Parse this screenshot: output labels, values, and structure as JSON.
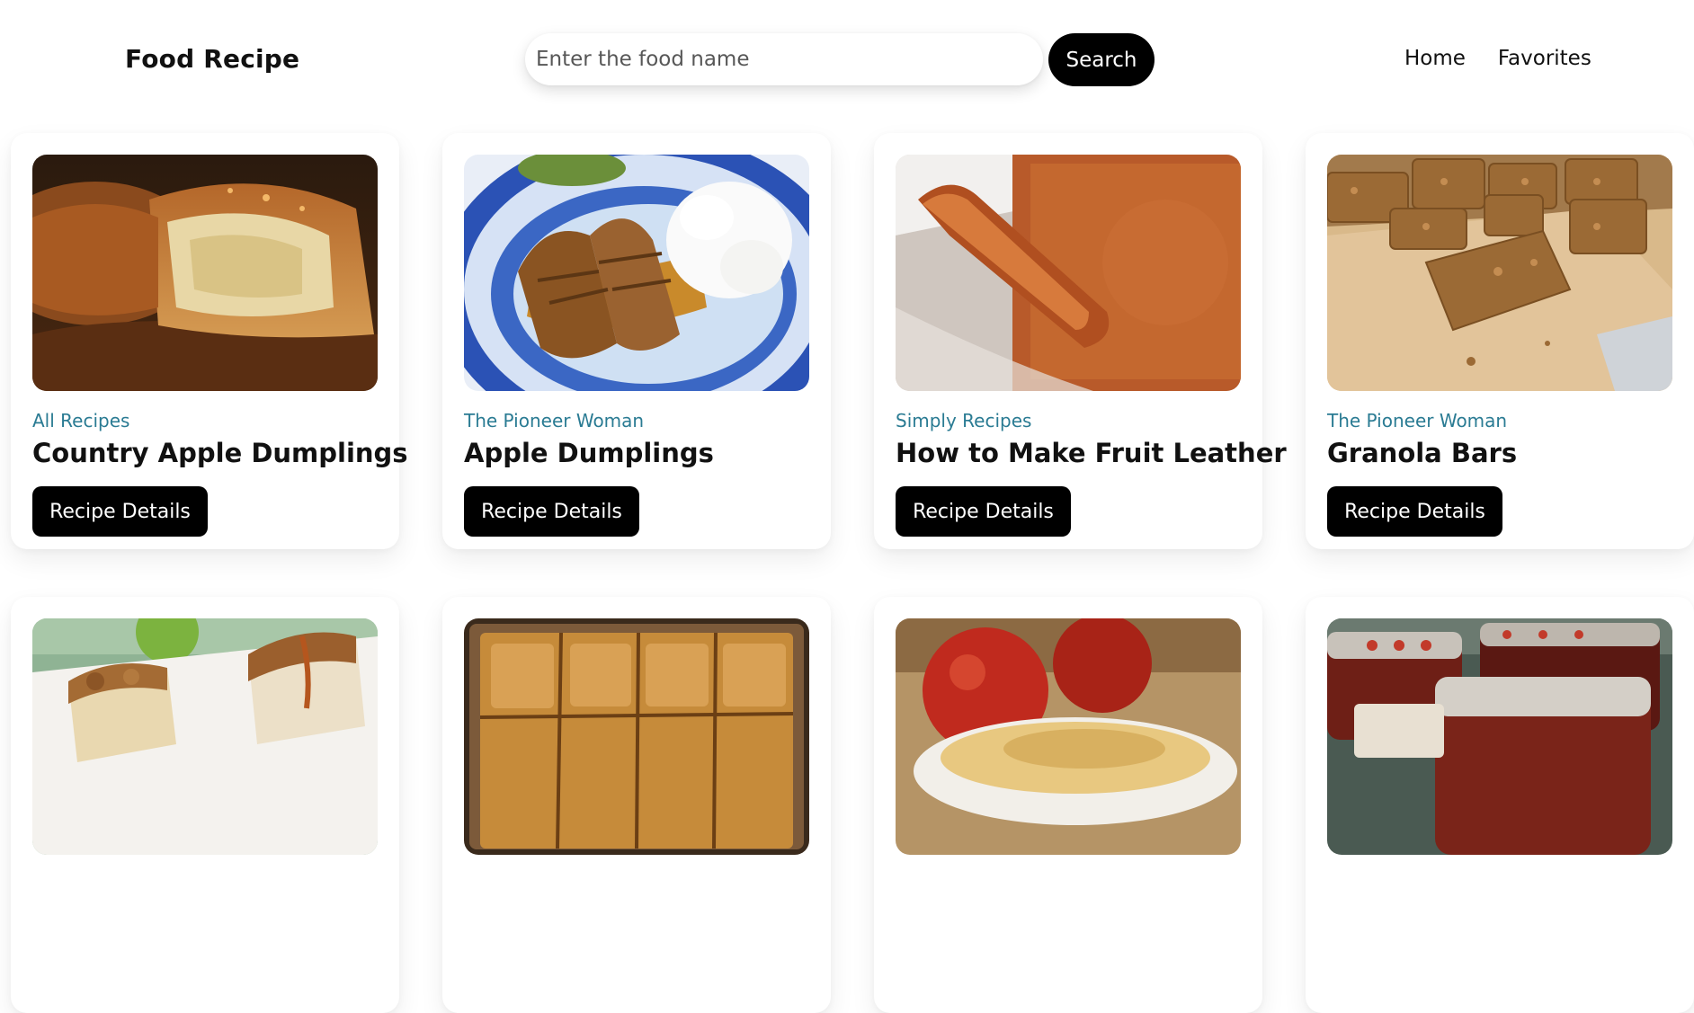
{
  "app": {
    "brand": "Food Recipe"
  },
  "search": {
    "placeholder": "Enter the food name",
    "value": "",
    "button_label": "Search"
  },
  "nav": {
    "home_label": "Home",
    "favorites_label": "Favorites"
  },
  "recipes": [
    {
      "publisher": "All Recipes",
      "title": "Country Apple Dumplings",
      "button_label": "Recipe Details",
      "image": "apple-dumpling-photo"
    },
    {
      "publisher": "The Pioneer Woman",
      "title": "Apple Dumplings",
      "button_label": "Recipe Details",
      "image": "apple-dumplings-ice-cream-photo"
    },
    {
      "publisher": "Simply Recipes",
      "title": "How to Make Fruit Leather",
      "button_label": "Recipe Details",
      "image": "fruit-leather-photo"
    },
    {
      "publisher": "The Pioneer Woman",
      "title": "Granola Bars",
      "button_label": "Recipe Details",
      "image": "granola-bars-photo"
    },
    {
      "image": "caramel-crumb-bars-photo"
    },
    {
      "image": "apple-slab-pie-photo"
    },
    {
      "image": "baked-apple-photo"
    },
    {
      "image": "apple-butter-jars-photo"
    }
  ],
  "colors": {
    "publisher_text": "#2a7b93",
    "button_bg": "#000000",
    "button_text": "#ffffff"
  }
}
